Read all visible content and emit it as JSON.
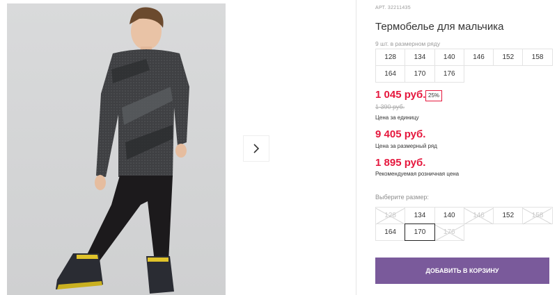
{
  "product": {
    "sku_label": "АРТ. 32211435",
    "title": "Термобелье для мальчика"
  },
  "gallery": {
    "next_icon": "chevron-right-icon"
  },
  "size_row": {
    "caption": "9 шт. в размерном ряду",
    "sizes": [
      "128",
      "134",
      "140",
      "146",
      "152",
      "158",
      "164",
      "170",
      "176"
    ]
  },
  "pricing": {
    "unit_price": "1 045 руб.",
    "discount_badge": "25%",
    "old_price": "1 390 руб.",
    "unit_price_note": "Цена за единицу",
    "row_price": "9 405 руб.",
    "row_price_note": "Цена за размерный ряд",
    "retail_price": "1 895 руб.",
    "retail_price_note": "Рекомендуемая розничная цена"
  },
  "size_select": {
    "label": "Выберите размер:",
    "options": [
      {
        "label": "128",
        "available": false,
        "selected": false
      },
      {
        "label": "134",
        "available": true,
        "selected": false
      },
      {
        "label": "140",
        "available": true,
        "selected": false
      },
      {
        "label": "146",
        "available": false,
        "selected": false
      },
      {
        "label": "152",
        "available": true,
        "selected": false
      },
      {
        "label": "158",
        "available": false,
        "selected": false
      },
      {
        "label": "164",
        "available": true,
        "selected": false
      },
      {
        "label": "170",
        "available": true,
        "selected": true
      },
      {
        "label": "176",
        "available": false,
        "selected": false
      }
    ]
  },
  "actions": {
    "add_to_cart": "Добавить в корзину"
  },
  "colors": {
    "price_red": "#e5173d",
    "button_purple": "#7a5a9b"
  }
}
